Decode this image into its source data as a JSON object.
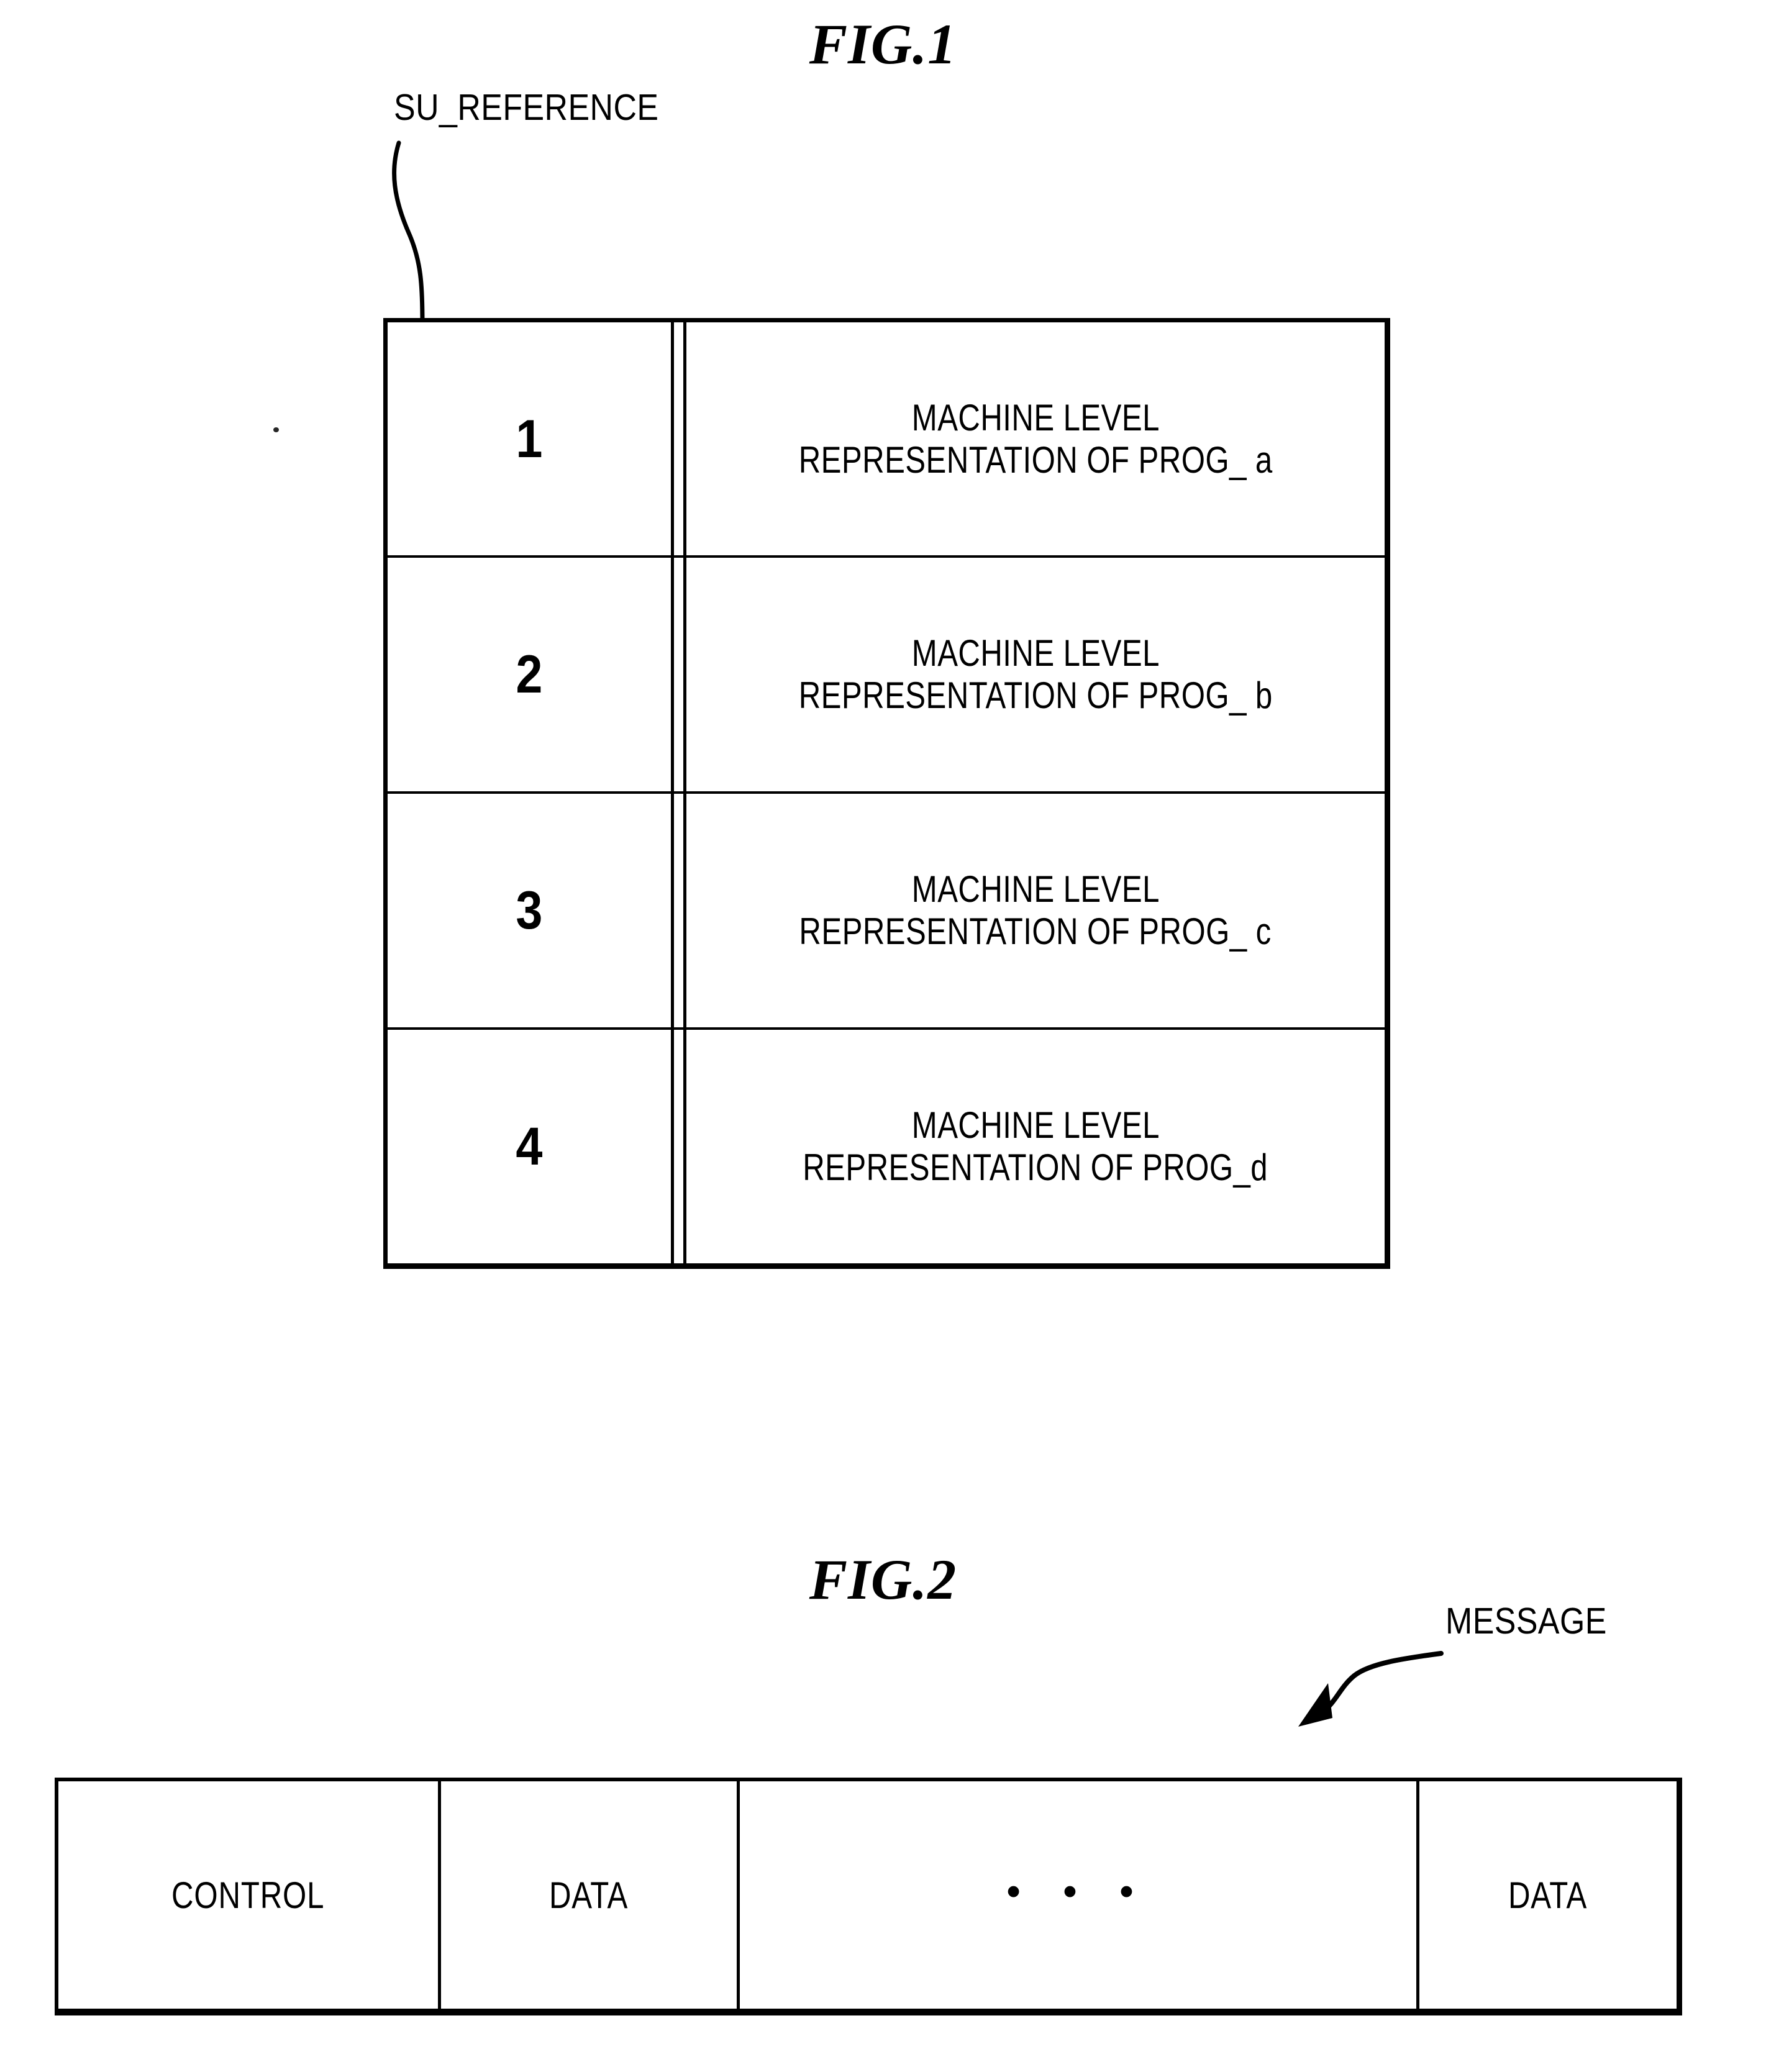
{
  "figures": [
    {
      "title": "FIG.1",
      "callout": {
        "label": "SU_REFERENCE"
      },
      "table": {
        "rows": [
          {
            "index": "1",
            "line1": "MACHINE LEVEL",
            "line2": "REPRESENTATION OF PROG_ a"
          },
          {
            "index": "2",
            "line1": "MACHINE LEVEL",
            "line2": "REPRESENTATION OF PROG_ b"
          },
          {
            "index": "3",
            "line1": "MACHINE LEVEL",
            "line2": "REPRESENTATION OF PROG_ c"
          },
          {
            "index": "4",
            "line1": "MACHINE LEVEL",
            "line2": "REPRESENTATION OF PROG_d"
          }
        ]
      }
    },
    {
      "title": "FIG.2",
      "callout": {
        "label": "MESSAGE"
      },
      "message_frame": {
        "fields": [
          {
            "label": "CONTROL"
          },
          {
            "label": "DATA"
          },
          {
            "label": "• • •"
          },
          {
            "label": "DATA"
          }
        ]
      }
    }
  ],
  "colors": {
    "ink": "#000000",
    "paper": "#ffffff"
  }
}
